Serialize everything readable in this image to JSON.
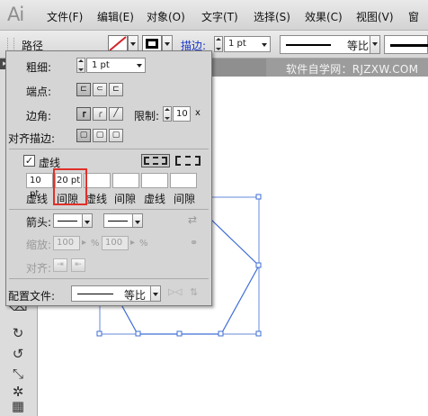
{
  "app": {
    "logo": "Ai"
  },
  "menubar": {
    "items": [
      "文件(F)",
      "编辑(E)",
      "对象(O)",
      "文字(T)",
      "选择(S)",
      "效果(C)",
      "视图(V)",
      "窗"
    ]
  },
  "control_bar": {
    "path_label": "路径",
    "stroke_link": "描边:",
    "stroke_weight": "1 pt",
    "profile_label": "等比"
  },
  "document": {
    "watermark": "软件自学网：RJZXW.COM"
  },
  "stroke_panel": {
    "weight_label": "粗细:",
    "weight_value": "1 pt",
    "cap_label": "端点:",
    "corner_label": "边角:",
    "limit_label": "限制:",
    "limit_value": "10",
    "limit_unit": "x",
    "align_label": "对齐描边:",
    "dashed_label": "虚线",
    "dashed_checked": true,
    "dash_fields": [
      {
        "value": "10 pt",
        "label": "虚线"
      },
      {
        "value": "20 pt",
        "label": "间隙"
      },
      {
        "value": "",
        "label": "虚线"
      },
      {
        "value": "",
        "label": "间隙"
      },
      {
        "value": "",
        "label": "虚线"
      },
      {
        "value": "",
        "label": "间隙"
      }
    ],
    "arrow_label": "箭头:",
    "scale_label": "缩放:",
    "scale_start": "100",
    "scale_end": "100",
    "percent": "%",
    "align_arrow_label": "对齐:",
    "profile_label": "配置文件:",
    "profile_value": "等比"
  },
  "colors": {
    "selection": "#3e6ed6",
    "highlight": "#e0302a",
    "link": "#1836c8"
  }
}
